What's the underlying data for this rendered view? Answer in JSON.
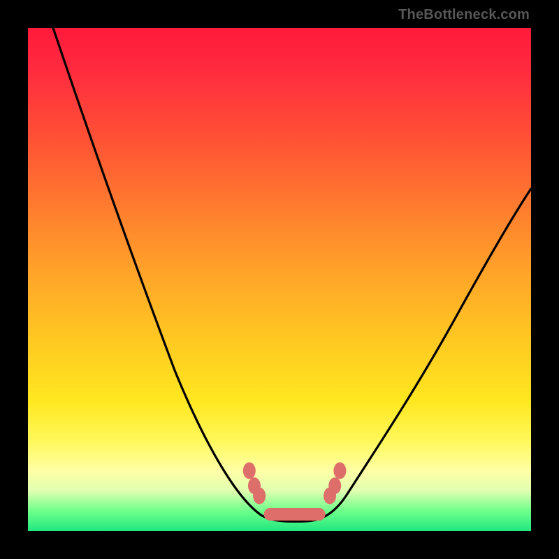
{
  "watermark": {
    "text": "TheBottleneck.com"
  },
  "colors": {
    "frame": "#000000",
    "curve_stroke": "#000000",
    "marker_fill": "#de6e69",
    "gradient_stops": [
      "#ff1a3a",
      "#ff5135",
      "#ffa229",
      "#ffe71f",
      "#ffffa5",
      "#20e880"
    ]
  },
  "chart_data": {
    "type": "line",
    "title": "",
    "xlabel": "",
    "ylabel": "",
    "xlim": [
      0,
      100
    ],
    "ylim": [
      0,
      100
    ],
    "grid": false,
    "legend": false,
    "description": "V-shaped bottleneck curve with a flat minimum region; y=0 (green) is optimal, y=100 (red) is worst. Left branch descends steeply from top-left, right branch ascends with gentler slope toward upper-right.",
    "series": [
      {
        "name": "bottleneck-curve",
        "x": [
          5,
          10,
          15,
          20,
          25,
          30,
          35,
          40,
          44,
          46,
          48,
          50,
          52,
          54,
          56,
          58,
          60,
          65,
          70,
          75,
          80,
          85,
          90,
          95,
          100
        ],
        "y": [
          100,
          87,
          74,
          62,
          50,
          39,
          29,
          20,
          12,
          9,
          6,
          4,
          3,
          3,
          3,
          4,
          6,
          11,
          18,
          26,
          34,
          42,
          50,
          57,
          63
        ]
      }
    ],
    "markers": {
      "name": "highlight-points",
      "description": "Salmon-colored rounded markers clustered around the curve's minimum.",
      "points": [
        {
          "x": 44,
          "y": 12
        },
        {
          "x": 45,
          "y": 9
        },
        {
          "x": 46,
          "y": 7
        },
        {
          "x": 48,
          "y": 4
        },
        {
          "x": 50,
          "y": 3
        },
        {
          "x": 52,
          "y": 3
        },
        {
          "x": 54,
          "y": 3
        },
        {
          "x": 56,
          "y": 3
        },
        {
          "x": 58,
          "y": 4
        },
        {
          "x": 60,
          "y": 7
        },
        {
          "x": 61,
          "y": 9
        },
        {
          "x": 62,
          "y": 12
        }
      ]
    }
  }
}
